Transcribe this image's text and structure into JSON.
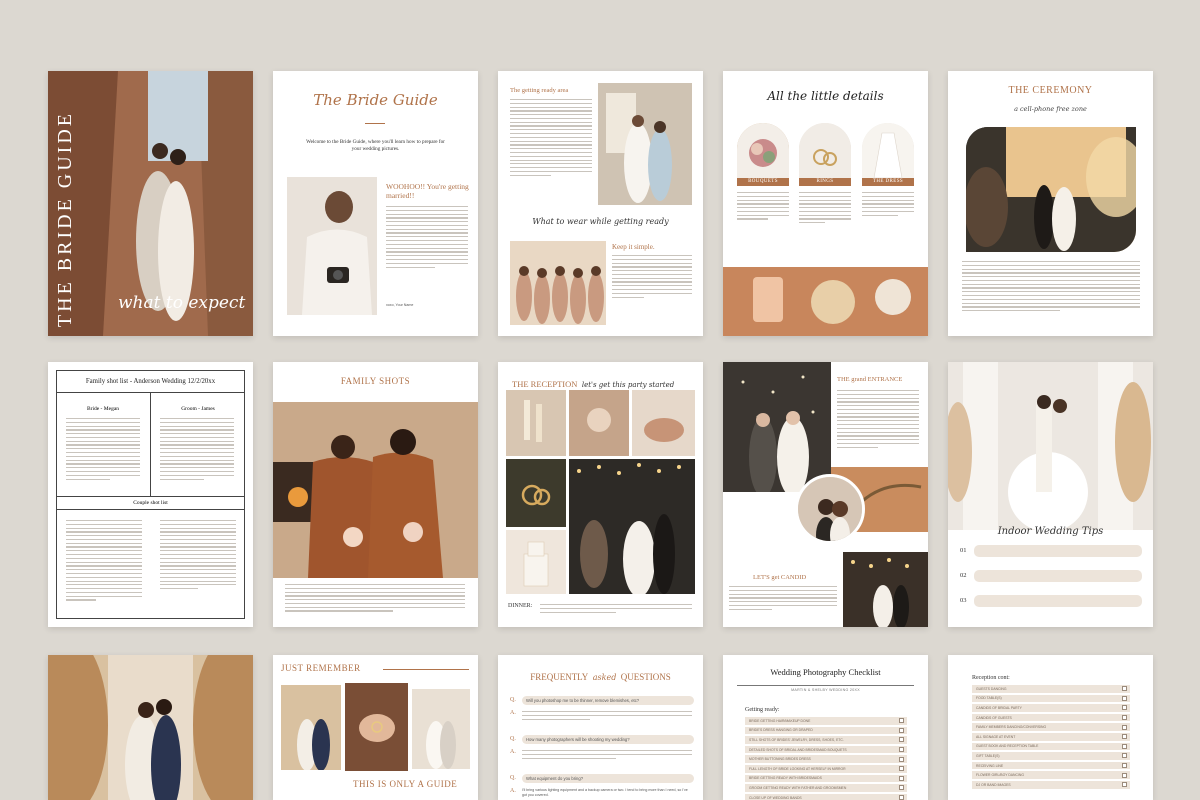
{
  "colors": {
    "background": "#dcd8d1",
    "accent": "#b0734a",
    "paper": "#ffffff"
  },
  "cover": {
    "title": "THE BRIDE GUIDE",
    "script": "what to expect"
  },
  "bride_guide": {
    "title": "The Bride Guide",
    "intro": "Welcome to the Bride Guide, where you'll learn how to prepare for your wedding pictures.",
    "heading": "WOOHOO!! You're getting married!!",
    "sign": "xoxo, Your Name"
  },
  "getting_ready": {
    "title": "The getting ready area",
    "section": "What to wear while getting ready",
    "keep": "Keep it simple."
  },
  "details": {
    "title": "All the little details",
    "labels": [
      "BOUQUETS",
      "RINGS",
      "THE DRESS"
    ]
  },
  "ceremony": {
    "title": "THE CEREMONY",
    "subtitle": "a cell-phone free zone"
  },
  "family_list": {
    "title": "Family shot list - Anderson Wedding 12/2/20xx",
    "bride_col": "Bride - Megan",
    "groom_col": "Groom - James",
    "couple_title": "Couple shot list"
  },
  "family_shots": {
    "title": "FAMILY SHOTS"
  },
  "reception": {
    "title": "THE RECEPTION",
    "script": "let's get this party started",
    "dinner": "DINNER:"
  },
  "grand_entrance": {
    "title": "THE grand ENTRANCE",
    "candid": "LET'S get CANDID"
  },
  "indoor": {
    "title": "Indoor Wedding Tips",
    "nums": [
      "01",
      "02",
      "03"
    ]
  },
  "remember": {
    "title": "JUST REMEMBER",
    "guide": "THIS IS ONLY A GUIDE"
  },
  "faq": {
    "title_a": "FREQUENTLY",
    "title_script": "asked",
    "title_b": "QUESTIONS",
    "q1": "Will you photoshop me to be thinner, remove blemishes, etc?",
    "q2": "How many photographers will be shooting my wedding?",
    "q3": "What equipment do you bring?",
    "a3": "I'll bring various lighting equipment and a backup camera or two. I tend to bring more than I need, so I've got you covered."
  },
  "checklist": {
    "title": "Wedding Photography Checklist",
    "sub": "MARTIN & SHELBY WEDDING 20XX",
    "section": "Getting ready:",
    "items": [
      "BRIDE GETTING HAIR/MAKEUP DONE",
      "BRIDE'S DRESS HANGING OR DRAPED",
      "STILL SHOTS OF BRIDES' JEWELRY, DRESS, SHOES, ETC.",
      "DETAILED SHOTS OF BRIDAL AND BRIDESMAID BOUQUETS",
      "MOTHER BUTTONING BRIDES DRESS",
      "FULL LENGTH OF BRIDE LOOKING AT HERSELF IN MIRROR",
      "BRIDE GETTING READY WITH BRIDESMAIDS",
      "GROOM GETTING READY WITH FATHER AND GROOMSMEN",
      "CLOSE UP OF WEDDING BANDS"
    ]
  },
  "reception_count": {
    "title": "Reception cont:",
    "items": [
      "GUESTS DANCING",
      "FOOD TABLE(S)",
      "CANDIDS OF BRIDAL PARTY",
      "CANDIDS OF GUESTS",
      "FAMILY MEMBERS DANCING/CONVERSING",
      "ALL SIGNAGE AT EVENT",
      "GUEST BOOK AND RECEPTION TABLE",
      "GIFT TABLE(S)",
      "RECEIVING LINE",
      "FLOWER GIRL/BOY DANCING",
      "DJ OR BAND IMAGES"
    ]
  }
}
